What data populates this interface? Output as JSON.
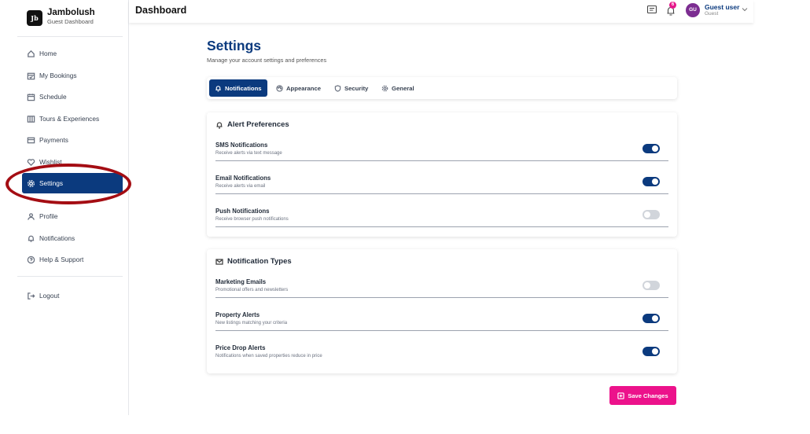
{
  "brand": {
    "name": "Jambolush",
    "subtitle": "Guest Dashboard",
    "logo_text": "Jb"
  },
  "sidebar": {
    "items": [
      {
        "label": "Home",
        "icon": "home-icon"
      },
      {
        "label": "My Bookings",
        "icon": "calendar-check-icon"
      },
      {
        "label": "Schedule",
        "icon": "calendar-icon"
      },
      {
        "label": "Tours & Experiences",
        "icon": "map-icon"
      },
      {
        "label": "Payments",
        "icon": "credit-card-icon"
      },
      {
        "label": "Wishlist",
        "icon": "heart-icon"
      },
      {
        "label": "Settings",
        "icon": "gear-icon",
        "active": true
      },
      {
        "label": "Profile",
        "icon": "user-icon"
      },
      {
        "label": "Notifications",
        "icon": "bell-icon"
      },
      {
        "label": "Help & Support",
        "icon": "help-circle-icon"
      },
      {
        "label": "Logout",
        "icon": "logout-icon"
      }
    ]
  },
  "header": {
    "title": "Dashboard",
    "notification_count": "6",
    "user": {
      "initials": "GU",
      "name": "Guest user",
      "role": "Guest"
    }
  },
  "page": {
    "title": "Settings",
    "subtitle": "Manage your account settings and preferences"
  },
  "tabs": [
    {
      "label": "Notifications",
      "icon": "bell-icon",
      "active": true
    },
    {
      "label": "Appearance",
      "icon": "palette-icon"
    },
    {
      "label": "Security",
      "icon": "shield-icon"
    },
    {
      "label": "General",
      "icon": "gear-icon"
    }
  ],
  "alert_preferences": {
    "title": "Alert Preferences",
    "rows": [
      {
        "label": "SMS Notifications",
        "desc": "Receive alerts via text message",
        "enabled": true
      },
      {
        "label": "Email Notifications",
        "desc": "Receive alerts via email",
        "enabled": true
      },
      {
        "label": "Push Notifications",
        "desc": "Receive browser push notifications",
        "enabled": false
      }
    ]
  },
  "notification_types": {
    "title": "Notification Types",
    "rows": [
      {
        "label": "Marketing Emails",
        "desc": "Promotional offers and newsletters",
        "enabled": false
      },
      {
        "label": "Property Alerts",
        "desc": "New listings matching your criteria",
        "enabled": true
      },
      {
        "label": "Price Drop Alerts",
        "desc": "Notifications when saved properties reduce in price",
        "enabled": true
      }
    ]
  },
  "save_button": {
    "label": "Save Changes"
  },
  "colors": {
    "primary": "#0b3a7e",
    "accent": "#ec128b",
    "highlight": "#a40d13"
  }
}
